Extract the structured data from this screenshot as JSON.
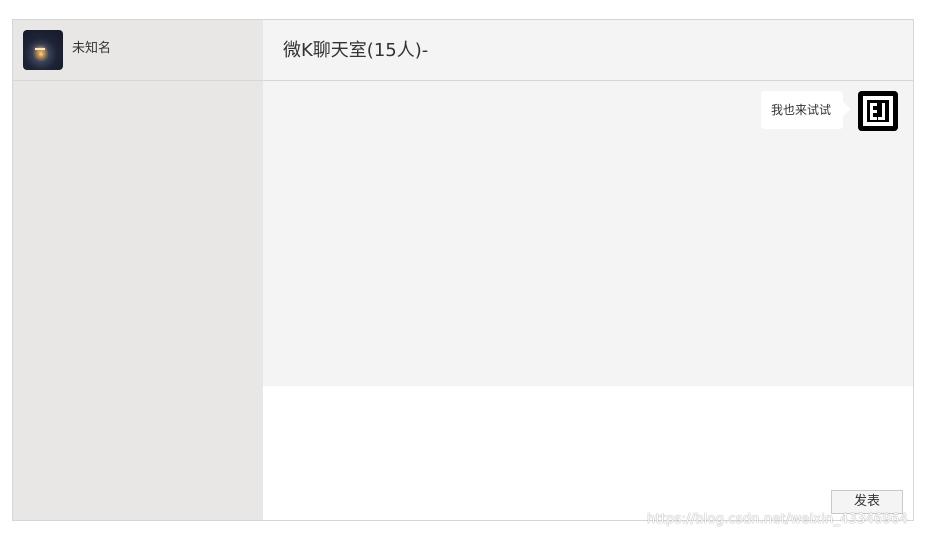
{
  "sidebar": {
    "user": {
      "name": "未知名",
      "avatar_icon": "night-lamp-avatar"
    }
  },
  "chat": {
    "room_title": "微K聊天室(15人)-",
    "messages": [
      {
        "text": "我也来试试",
        "side": "right",
        "avatar_icon": "ej-logo-avatar"
      }
    ]
  },
  "composer": {
    "send_label": "发表"
  },
  "watermark": "https://blog.csdn.net/weixin_43346964",
  "colors": {
    "sidebar_bg": "#e8e7e5",
    "panel_bg": "#f4f4f4",
    "bubble_bg": "#ffffff",
    "border": "#d6d6d6"
  }
}
